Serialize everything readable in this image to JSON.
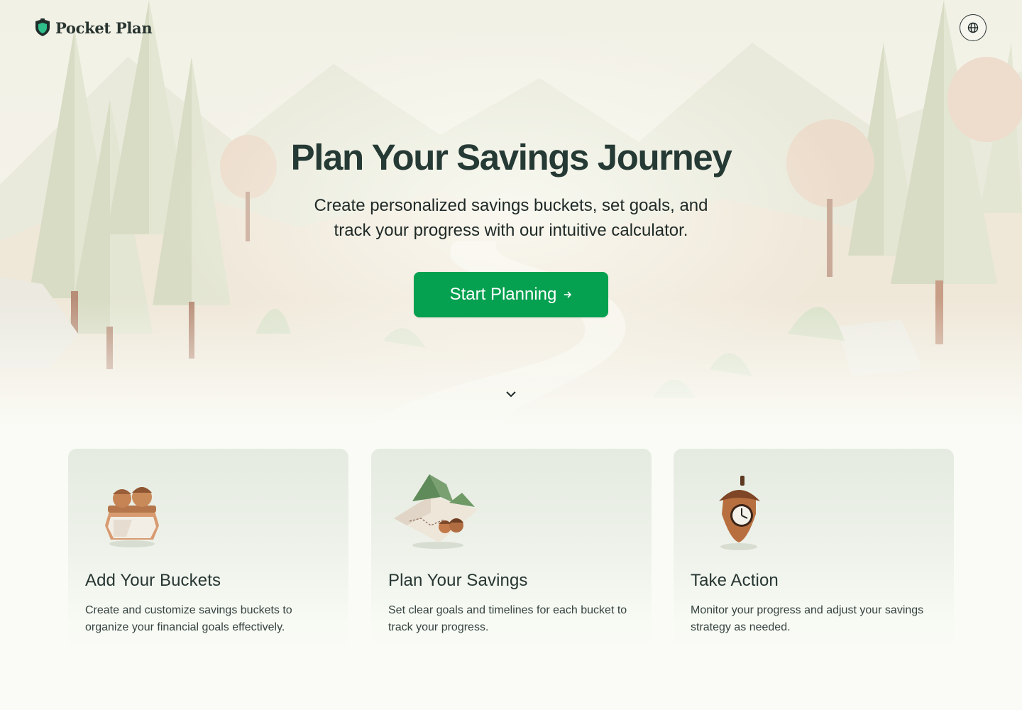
{
  "brand": {
    "name": "Pocket Plan"
  },
  "header": {
    "language_icon": "globe-icon"
  },
  "hero": {
    "title": "Plan Your Savings Journey",
    "subtitle": "Create personalized savings buckets, set goals, and track your progress with our intuitive calculator.",
    "cta_label": "Start Planning",
    "cta_icon": "arrow-right-icon",
    "scroll_icon": "chevron-down-icon"
  },
  "features": [
    {
      "icon": "acorn-jar-icon",
      "title": "Add Your Buckets",
      "description": "Create and customize savings buckets to organize your financial goals effectively."
    },
    {
      "icon": "map-acorn-icon",
      "title": "Plan Your Savings",
      "description": "Set clear goals and timelines for each bucket to track your progress."
    },
    {
      "icon": "acorn-clock-icon",
      "title": "Take Action",
      "description": "Monitor your progress and adjust your savings strategy as needed."
    }
  ],
  "colors": {
    "accent": "#05a050",
    "text": "#263a35",
    "background": "#fafbf6"
  }
}
